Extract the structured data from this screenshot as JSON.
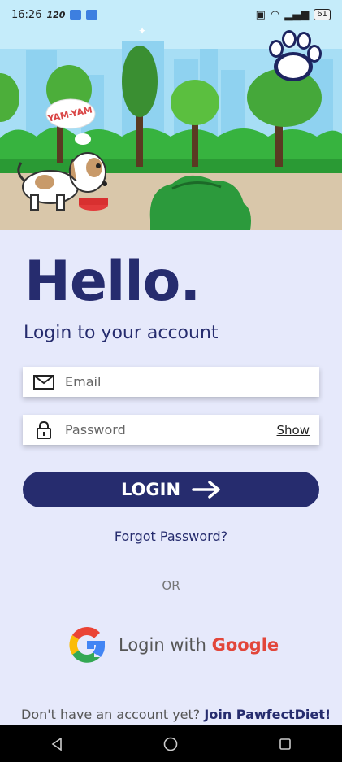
{
  "status_bar": {
    "time": "16:26",
    "network_speed": "120",
    "battery": "61"
  },
  "hero": {
    "speech_bubble": "YAM-YAM"
  },
  "login": {
    "title": "Hello.",
    "subtitle": "Login to your account",
    "email_placeholder": "Email",
    "password_placeholder": "Password",
    "show_label": "Show",
    "login_button": "LOGIN",
    "forgot_password": "Forgot Password?",
    "or_label": "OR",
    "google_prefix": "Login with",
    "google_word": "Google",
    "no_account": "Don't have an account yet?",
    "join_label": "Join PawfectDiet!"
  },
  "colors": {
    "primary": "#262c6e",
    "background": "#e6e9fb",
    "google_red": "#e2463a"
  }
}
